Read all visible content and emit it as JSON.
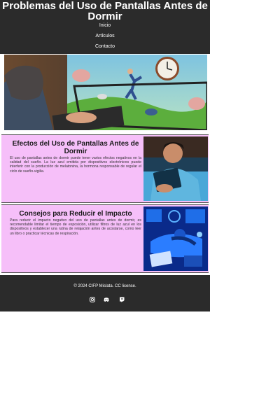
{
  "header": {
    "title": "Problemas del Uso de Pantallas Antes de Dormir",
    "nav": [
      "Inicio",
      "Artículos",
      "Contacto"
    ]
  },
  "hero": {
    "icon": "hero-illustration"
  },
  "sections": [
    {
      "title": "Efectos del Uso de Pantallas Antes de Dormir",
      "text": "El uso de pantallas antes de dormir puede tener varios efectos negativos en la calidad del sueño. La luz azul emitida por dispositivos electrónicos puede interferir con la producción de melatonina, la hormona responsable de regular el ciclo de sueño-vigilia."
    },
    {
      "title": "Consejos para Reducir el Impacto",
      "text": "Para reducir el impacto negativo del uso de pantallas antes de dormir, es recomendable limitar el tiempo de exposición, utilizar filtros de luz azul en los dispositivos y establecer una rutina de relajación antes de acostarse, como leer un libro o practicar técnicas de respiración."
    }
  ],
  "footer": {
    "copyright": "© 2024 CIFP Mislata. CC license.",
    "icons": [
      "instagram-icon",
      "discord-icon",
      "twitch-icon"
    ]
  },
  "colors": {
    "dark": "#2b2b2b",
    "section_bg": "#f6bff9"
  }
}
